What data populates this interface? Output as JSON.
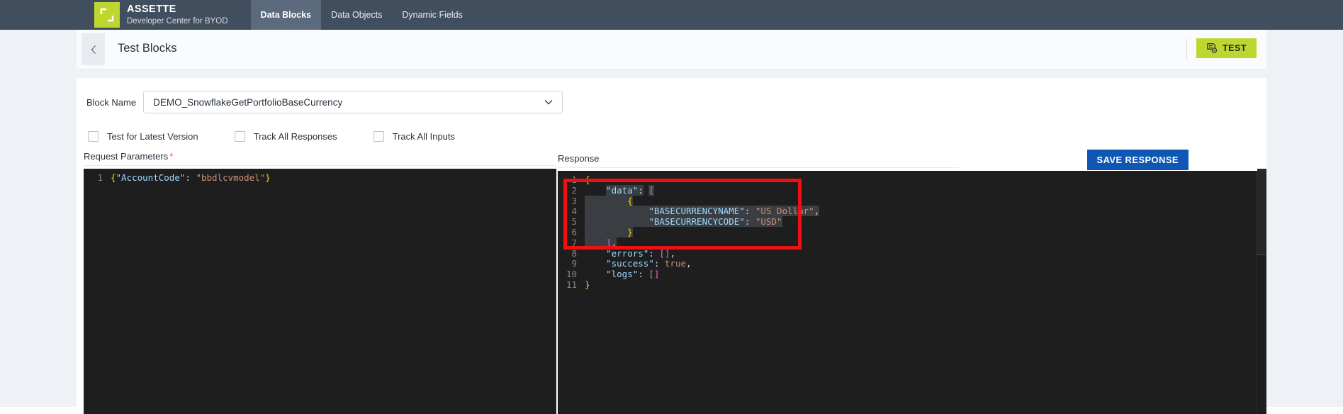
{
  "topbar": {
    "logo_icon": "crop-brackets-logo",
    "brand_name": "ASSETTE",
    "brand_subtitle": "Developer Center for BYOD",
    "tabs": [
      {
        "label": "Data Blocks",
        "active": true
      },
      {
        "label": "Data Objects",
        "active": false
      },
      {
        "label": "Dynamic Fields",
        "active": false
      }
    ],
    "bg_color": "#414e5e",
    "active_tab_bg": "#5b6b7d",
    "logo_color": "#bed62f"
  },
  "header": {
    "back_icon": "chevron-left-icon",
    "title": "Test Blocks",
    "test_button": {
      "label": "TEST",
      "icon": "test-document-gear-icon",
      "color": "#bed62f"
    }
  },
  "form": {
    "block_name_label": "Block Name",
    "block_name_value": "DEMO_SnowflakeGetPortfolioBaseCurrency",
    "dropdown_icon": "chevron-down-icon",
    "checkboxes": [
      {
        "label": "Test for Latest Version",
        "checked": false
      },
      {
        "label": "Track All Responses",
        "checked": false
      },
      {
        "label": "Track All Inputs",
        "checked": false
      }
    ]
  },
  "request_panel": {
    "label": "Request Parameters",
    "required_marker": "*",
    "lines": [
      {
        "number": "1",
        "tokens": [
          {
            "text": "{",
            "type": "punc"
          },
          {
            "text": "\"AccountCode\"",
            "type": "key"
          },
          {
            "text": ": ",
            "type": "plain"
          },
          {
            "text": "\"bbdlcvmodel\"",
            "type": "str"
          },
          {
            "text": "}",
            "type": "punc"
          }
        ]
      }
    ]
  },
  "response_panel": {
    "label": "Response",
    "save_button_label": "SAVE RESPONSE",
    "save_button_color": "#0f57b3",
    "lines": [
      {
        "number": "1",
        "tokens": [
          {
            "text": "{",
            "type": "punc"
          }
        ]
      },
      {
        "number": "2",
        "tokens": [
          {
            "text": "    ",
            "type": "plain"
          },
          {
            "text": "\"data\"",
            "type": "key",
            "sel": true
          },
          {
            "text": ":",
            "type": "plain",
            "sel": true
          },
          {
            "text": " ",
            "type": "plain"
          },
          {
            "text": "[",
            "type": "brack",
            "sel": true
          }
        ]
      },
      {
        "number": "3",
        "tokens": [
          {
            "text": "····",
            "type": "guide",
            "sel": true
          },
          {
            "text": "····",
            "type": "guide",
            "sel": true
          },
          {
            "text": "{",
            "type": "punc",
            "sel": true
          }
        ]
      },
      {
        "number": "4",
        "tokens": [
          {
            "text": "····",
            "type": "guide",
            "sel": true
          },
          {
            "text": "····",
            "type": "guide",
            "sel": true
          },
          {
            "text": "····",
            "type": "guide",
            "sel": true
          },
          {
            "text": "\"BASECURRENCYNAME\"",
            "type": "key",
            "sel": true
          },
          {
            "text": ": ",
            "type": "plain",
            "sel": true
          },
          {
            "text": "\"US Dollar\"",
            "type": "str",
            "sel": true
          },
          {
            "text": ",",
            "type": "plain",
            "sel": true
          }
        ]
      },
      {
        "number": "5",
        "tokens": [
          {
            "text": "····",
            "type": "guide",
            "sel": true
          },
          {
            "text": "····",
            "type": "guide",
            "sel": true
          },
          {
            "text": "····",
            "type": "guide",
            "sel": true
          },
          {
            "text": "\"BASECURRENCYCODE\"",
            "type": "key",
            "sel": true
          },
          {
            "text": ": ",
            "type": "plain",
            "sel": true
          },
          {
            "text": "\"USD\"",
            "type": "str",
            "sel": true
          }
        ]
      },
      {
        "number": "6",
        "tokens": [
          {
            "text": "····",
            "type": "guide",
            "sel": true
          },
          {
            "text": "····",
            "type": "guide",
            "sel": true
          },
          {
            "text": "}",
            "type": "punc",
            "sel": true
          }
        ]
      },
      {
        "number": "7",
        "tokens": [
          {
            "text": "····",
            "type": "guide",
            "sel": true
          },
          {
            "text": "]",
            "type": "brack",
            "sel": true
          },
          {
            "text": ",",
            "type": "plain",
            "sel": true
          }
        ]
      },
      {
        "number": "8",
        "tokens": [
          {
            "text": "    ",
            "type": "plain"
          },
          {
            "text": "\"errors\"",
            "type": "key"
          },
          {
            "text": ": ",
            "type": "plain"
          },
          {
            "text": "[]",
            "type": "brack"
          },
          {
            "text": ",",
            "type": "plain"
          }
        ]
      },
      {
        "number": "9",
        "tokens": [
          {
            "text": "    ",
            "type": "plain"
          },
          {
            "text": "\"success\"",
            "type": "key"
          },
          {
            "text": ": ",
            "type": "plain"
          },
          {
            "text": "true",
            "type": "bool"
          },
          {
            "text": ",",
            "type": "plain"
          }
        ]
      },
      {
        "number": "10",
        "tokens": [
          {
            "text": "    ",
            "type": "plain"
          },
          {
            "text": "\"logs\"",
            "type": "key"
          },
          {
            "text": ": ",
            "type": "plain"
          },
          {
            "text": "[]",
            "type": "brack"
          }
        ]
      },
      {
        "number": "11",
        "tokens": [
          {
            "text": "}",
            "type": "punc"
          }
        ]
      }
    ]
  },
  "annotation": {
    "type": "red-rectangle-highlight",
    "color": "#ee1111"
  }
}
